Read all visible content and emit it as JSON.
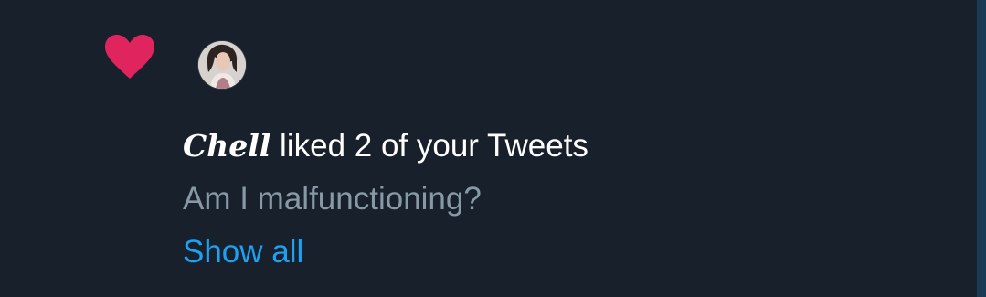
{
  "notification": {
    "type_icon": "heart-icon",
    "user_avatar": "avatar",
    "user_name": "Chell",
    "action_text": " liked 2 of your Tweets",
    "tweet_preview": "Am I malfunctioning?",
    "show_all_label": "Show all"
  },
  "colors": {
    "background": "#17202b",
    "heart": "#e0245e",
    "text_primary": "#ffffff",
    "text_secondary": "#8899a6",
    "link": "#1da1f2",
    "scroll_edge": "#1a3a55"
  }
}
